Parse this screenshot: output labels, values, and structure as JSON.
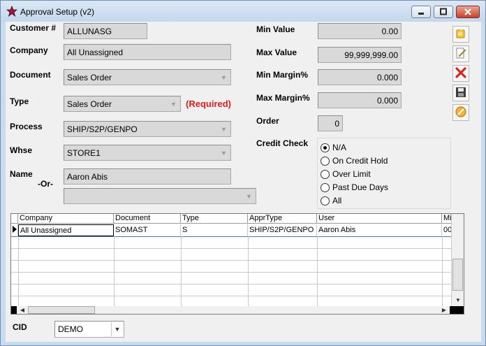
{
  "window": {
    "title": "Approval Setup (v2)"
  },
  "form": {
    "customer_label": "Customer #",
    "customer_value": "ALLUNASG",
    "company_label": "Company",
    "company_value": "All Unassigned",
    "document_label": "Document",
    "document_value": "Sales Order",
    "type_label": "Type",
    "type_value": "Sales Order",
    "required_text": "(Required)",
    "process_label": "Process",
    "process_value": "SHIP/S2P/GENPO",
    "whse_label": "Whse",
    "whse_value": "STORE1",
    "name_label": "Name",
    "name_value": "Aaron Abis",
    "or_label": "-Or-",
    "alt_value": "",
    "min_value_label": "Min Value",
    "min_value": "0.00",
    "max_value_label": "Max Value",
    "max_value": "99,999,999.00",
    "min_margin_label": "Min Margin%",
    "min_margin": "0.000",
    "max_margin_label": "Max Margin%",
    "max_margin": "0.000",
    "order_label": "Order",
    "order_value": "0",
    "credit_check_label": "Credit Check",
    "credit_options": [
      "N/A",
      "On Credit Hold",
      "Over Limit",
      "Past Due Days",
      "All"
    ],
    "credit_selected": 0,
    "cid_label": "CID",
    "cid_value": "DEMO"
  },
  "toolbar": {
    "icons": [
      "new-icon",
      "edit-icon",
      "delete-icon",
      "save-icon",
      "cancel-icon"
    ]
  },
  "grid": {
    "columns": [
      "Company",
      "Document",
      "Type",
      "ApprType",
      "User",
      "Mi"
    ],
    "rows": [
      [
        "All Unassigned",
        "SOMAST",
        "S",
        "SHIP/S2P/GENPO",
        "Aaron Abis",
        "00"
      ]
    ]
  }
}
